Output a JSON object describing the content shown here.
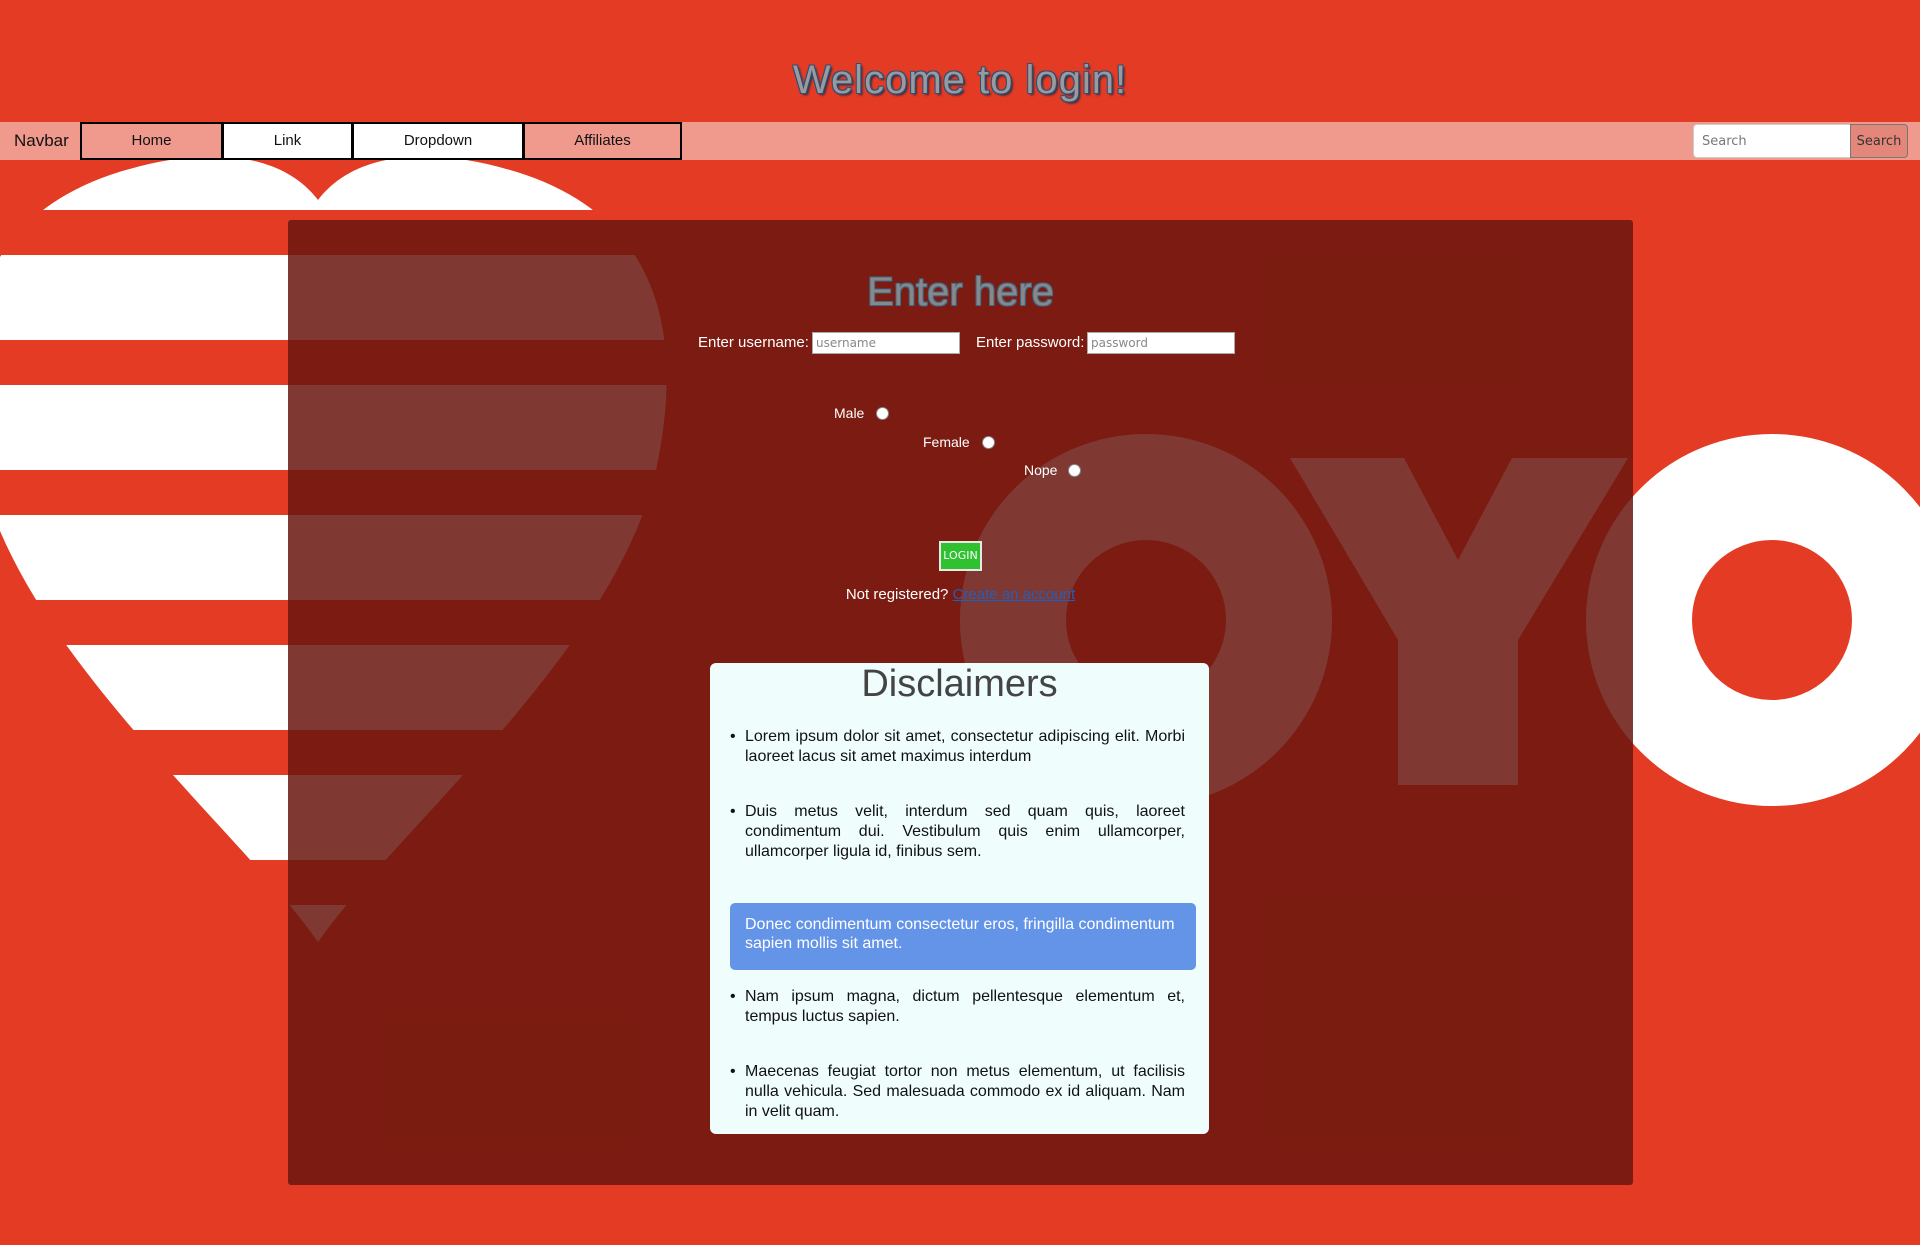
{
  "header": {
    "title": "Welcome to login!"
  },
  "navbar": {
    "brand": "Navbar",
    "items": [
      {
        "label": "Home"
      },
      {
        "label": "Link"
      },
      {
        "label": "Dropdown"
      },
      {
        "label": "Affiliates"
      }
    ],
    "search": {
      "placeholder": "Search",
      "button_label": "Search"
    }
  },
  "login": {
    "title": "Enter here",
    "username_label": "Enter username:",
    "username_placeholder": "username",
    "password_label": "Enter password:",
    "password_placeholder": "password",
    "gender_options": [
      "Male",
      "Female",
      "Nope"
    ],
    "login_button": "LOGIN",
    "register_text": "Not registered?",
    "register_link": "Create an account"
  },
  "disclaimers": {
    "title": "Disclaimers",
    "items": [
      "Lorem ipsum dolor sit amet, consectetur adipiscing elit. Morbi laoreet lacus sit amet maximus interdum",
      "Duis metus velit, interdum sed quam quis, laoreet condimentum dui. Vestibulum quis enim ullamcorper, ullamcorper ligula id, finibus sem.",
      "Donec condimentum consectetur eros, fringilla condimentum sapien mollis sit amet.",
      "Nam ipsum magna, dictum pellentesque elementum et, tempus luctus sapien.",
      "Maecenas feugiat tortor non metus elementum, ut facilisis nulla vehicula. Sed malesuada commodo ex id aliquam. Nam in velit quam."
    ]
  },
  "colors": {
    "background": "#e43b24",
    "navbar": "#f09a8e",
    "panel": "#69160e",
    "login_button": "#2fc12f",
    "highlight": "#6494e8"
  },
  "background_logo": {
    "icon": "oyo-heart-logo",
    "text": "OYO"
  }
}
